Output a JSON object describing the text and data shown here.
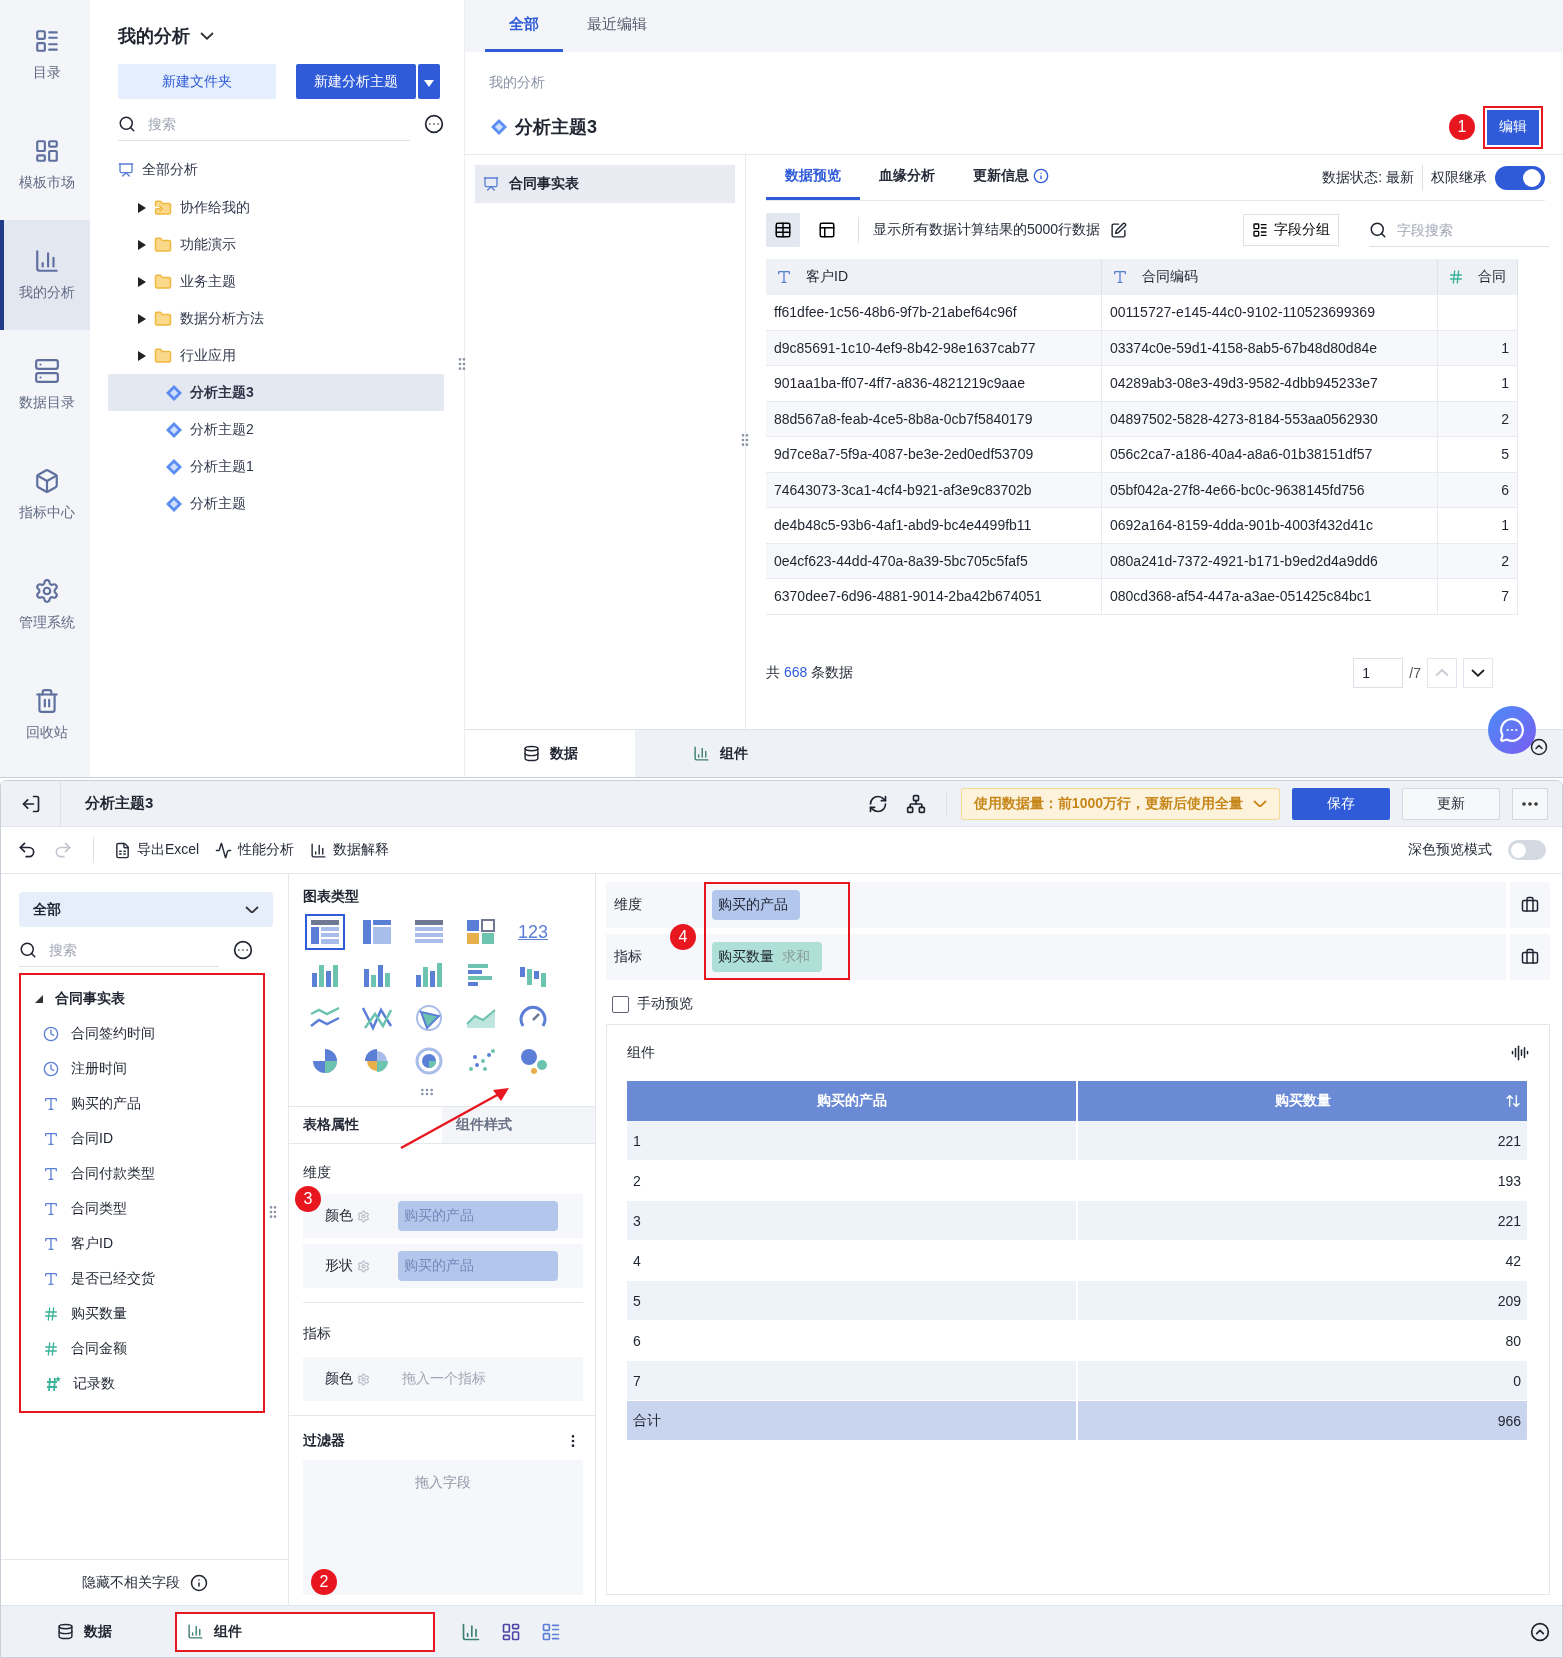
{
  "nav": [
    {
      "label": "目录",
      "selected": false
    },
    {
      "label": "模板市场",
      "selected": false
    },
    {
      "label": "我的分析",
      "selected": true
    },
    {
      "label": "数据目录",
      "selected": false
    },
    {
      "label": "指标中心",
      "selected": false
    },
    {
      "label": "管理系统",
      "selected": false
    },
    {
      "label": "回收站",
      "selected": false
    }
  ],
  "tree_panel": {
    "title": "我的分析",
    "new_folder": "新建文件夹",
    "new_subject": "新建分析主题",
    "search_placeholder": "搜索",
    "root": "全部分析",
    "folders": [
      {
        "label": "协作给我的",
        "kind": "shared"
      },
      {
        "label": "功能演示",
        "kind": "folder"
      },
      {
        "label": "业务主题",
        "kind": "folder"
      },
      {
        "label": "数据分析方法",
        "kind": "folder"
      },
      {
        "label": "行业应用",
        "kind": "folder"
      }
    ],
    "subjects": [
      {
        "label": "分析主题3",
        "selected": true
      },
      {
        "label": "分析主题2",
        "selected": false
      },
      {
        "label": "分析主题1",
        "selected": false
      },
      {
        "label": "分析主题",
        "selected": false
      }
    ]
  },
  "top_tabs": [
    {
      "label": "全部",
      "selected": true
    },
    {
      "label": "最近编辑",
      "selected": false
    }
  ],
  "breadcrumb": "我的分析",
  "subject_title": "分析主题3",
  "edit_callout": "1",
  "edit_button": "编辑",
  "tables_list": [
    {
      "label": "合同事实表",
      "selected": true
    }
  ],
  "detail_tabs": [
    {
      "label": "数据预览",
      "selected": true,
      "info": false
    },
    {
      "label": "血缘分析",
      "selected": false,
      "info": false
    },
    {
      "label": "更新信息",
      "selected": false,
      "info": true
    }
  ],
  "data_status": "数据状态: 最新",
  "permission": {
    "label": "权限继承",
    "on": true
  },
  "view_modes": [
    {
      "selected": true
    },
    {
      "selected": false
    }
  ],
  "preview_note": "显示所有数据计算结果的5000行数据",
  "group_button": "字段分组",
  "field_search_placeholder": "字段搜索",
  "preview_table": {
    "columns": [
      {
        "kind": "text",
        "label": "客户ID"
      },
      {
        "kind": "text",
        "label": "合同编码"
      },
      {
        "kind": "number",
        "label": "合同"
      }
    ],
    "rows": [
      [
        "ff61dfee-1c56-48b6-9f7b-21abef64c96f",
        "00115727-e145-44c0-9102-110523699369",
        ""
      ],
      [
        "d9c85691-1c10-4ef9-8b42-98e1637cab77",
        "03374c0e-59d1-4158-8ab5-67b48d80d84e",
        "1"
      ],
      [
        "901aa1ba-ff07-4ff7-a836-4821219c9aae",
        "04289ab3-08e3-49d3-9582-4dbb945233e7",
        "1"
      ],
      [
        "88d567a8-feab-4ce5-8b8a-0cb7f5840179",
        "04897502-5828-4273-8184-553aa0562930",
        "2"
      ],
      [
        "9d7ce8a7-5f9a-4087-be3e-2ed0edf53709",
        "056c2ca7-a186-40a4-a8a6-01b38151df57",
        "5"
      ],
      [
        "74643073-3ca1-4cf4-b921-af3e9c83702b",
        "05bf042a-27f8-4e66-bc0c-9638145fd756",
        "6"
      ],
      [
        "de4b48c5-93b6-4af1-abd9-bc4e4499fb11",
        "0692a164-8159-4dda-901b-4003f432d41c",
        "1"
      ],
      [
        "0e4cf623-44dd-470a-8a39-5bc705c5faf5",
        "080a241d-7372-4921-b171-b9ed2d4a9dd6",
        "2"
      ],
      [
        "6370dee7-6d96-4881-9014-2ba42b674051",
        "080cd368-af54-447a-a3ae-051425c84bc1",
        "7"
      ]
    ]
  },
  "total": {
    "prefix": "共",
    "count": "668",
    "suffix": "条数据"
  },
  "pager": {
    "page": "1",
    "pages": "/7"
  },
  "top_bottom_tabs": [
    {
      "label": "数据",
      "selected": true
    },
    {
      "label": "组件",
      "selected": false
    }
  ],
  "editor": {
    "title": "分析主题3",
    "data_notice": "使用数据量：前1000万行，更新后使用全量",
    "save": "保存",
    "update": "更新",
    "tools": [
      "导出Excel",
      "性能分析",
      "数据解释"
    ],
    "dark_mode": {
      "label": "深色预览模式",
      "on": false
    },
    "field_filter": "全部",
    "field_search_placeholder": "搜索",
    "field_group": "合同事实表",
    "fields": [
      {
        "kind": "date",
        "label": "合同签约时间"
      },
      {
        "kind": "date",
        "label": "注册时间"
      },
      {
        "kind": "text",
        "label": "购买的产品"
      },
      {
        "kind": "text",
        "label": "合同ID"
      },
      {
        "kind": "text",
        "label": "合同付款类型"
      },
      {
        "kind": "text",
        "label": "合同类型"
      },
      {
        "kind": "text",
        "label": "客户ID"
      },
      {
        "kind": "text",
        "label": "是否已经交货"
      },
      {
        "kind": "number",
        "label": "购买数量"
      },
      {
        "kind": "number",
        "label": "合同金额"
      },
      {
        "kind": "count",
        "label": "记录数"
      }
    ],
    "hide_irrelevant": "隐藏不相关字段",
    "chart_types_title": "图表类型",
    "chart_types": [
      {
        "kind": "table",
        "selected": true
      },
      {
        "kind": "cross",
        "selected": false
      },
      {
        "kind": "detail",
        "selected": false
      },
      {
        "kind": "blocks",
        "selected": false
      },
      {
        "kind": "kpi",
        "label": "123",
        "selected": false
      },
      {
        "kind": "stacked",
        "selected": false
      },
      {
        "kind": "grouped",
        "selected": false
      },
      {
        "kind": "bar",
        "selected": false
      },
      {
        "kind": "hbar",
        "selected": false
      },
      {
        "kind": "waterfall",
        "selected": false
      },
      {
        "kind": "dualline",
        "selected": false
      },
      {
        "kind": "line",
        "selected": false
      },
      {
        "kind": "radar",
        "selected": false
      },
      {
        "kind": "area",
        "selected": false
      },
      {
        "kind": "gauge",
        "selected": false
      },
      {
        "kind": "pie",
        "selected": false
      },
      {
        "kind": "rose",
        "selected": false
      },
      {
        "kind": "ring",
        "selected": false
      },
      {
        "kind": "scatter",
        "selected": false
      },
      {
        "kind": "bubble",
        "selected": false
      }
    ],
    "config_tabs": [
      {
        "label": "表格属性",
        "selected": true
      },
      {
        "label": "组件样式",
        "selected": false
      }
    ],
    "dimension_section": "维度",
    "dimension_callout": "3",
    "dimension_slots": [
      {
        "label": "颜色",
        "value": "购买的产品"
      },
      {
        "label": "形状",
        "value": "购买的产品"
      }
    ],
    "measure_section": "指标",
    "measure_slots": [
      {
        "label": "颜色",
        "placeholder": "拖入一个指标"
      }
    ],
    "filter_title": "过滤器",
    "filter_placeholder": "拖入字段",
    "bottom_callout": "2",
    "shelves": [
      {
        "label": "维度",
        "chip": "购买的产品",
        "kind": "dimension"
      },
      {
        "label": "指标",
        "chip": "购买数量",
        "aggregate": "求和",
        "kind": "measure"
      }
    ],
    "shelves_callout": "4",
    "manual_preview": {
      "label": "手动预览",
      "checked": false
    },
    "widget": {
      "title": "组件",
      "columns": [
        "购买的产品",
        "购买数量"
      ],
      "rows": [
        [
          "1",
          "221"
        ],
        [
          "2",
          "193"
        ],
        [
          "3",
          "221"
        ],
        [
          "4",
          "42"
        ],
        [
          "5",
          "209"
        ],
        [
          "6",
          "80"
        ],
        [
          "7",
          "0"
        ]
      ],
      "total": [
        "合计",
        "966"
      ]
    },
    "bottom_tabs": [
      {
        "label": "数据",
        "selected": false
      },
      {
        "label": "组件",
        "selected": true
      }
    ]
  }
}
